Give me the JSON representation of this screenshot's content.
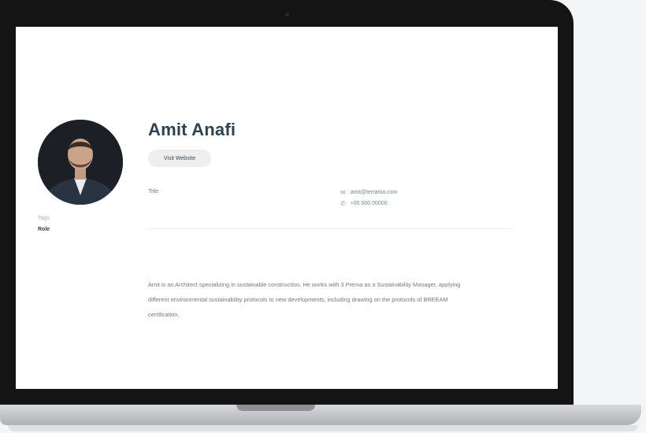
{
  "profile": {
    "name": "Amit Anafi",
    "website_button": "Visit Website",
    "side_label": "Tags",
    "side_value": "Role",
    "row_label": "Title",
    "email": "amit@terrama.com",
    "phone": "+00 000 00000",
    "bio": "Amit is an Architect specializing in sustainable construction. He works with 3 Prema as a Sustainability Manager, applying different environmental sustainability protocols to new developments, including drawing on the protocols of BREEAM certification."
  },
  "icons": {
    "email": "mail-icon",
    "phone": "phone-icon"
  },
  "colors": {
    "name": "#2f4250",
    "contact": "#6a8b83",
    "bezel": "#141414"
  }
}
